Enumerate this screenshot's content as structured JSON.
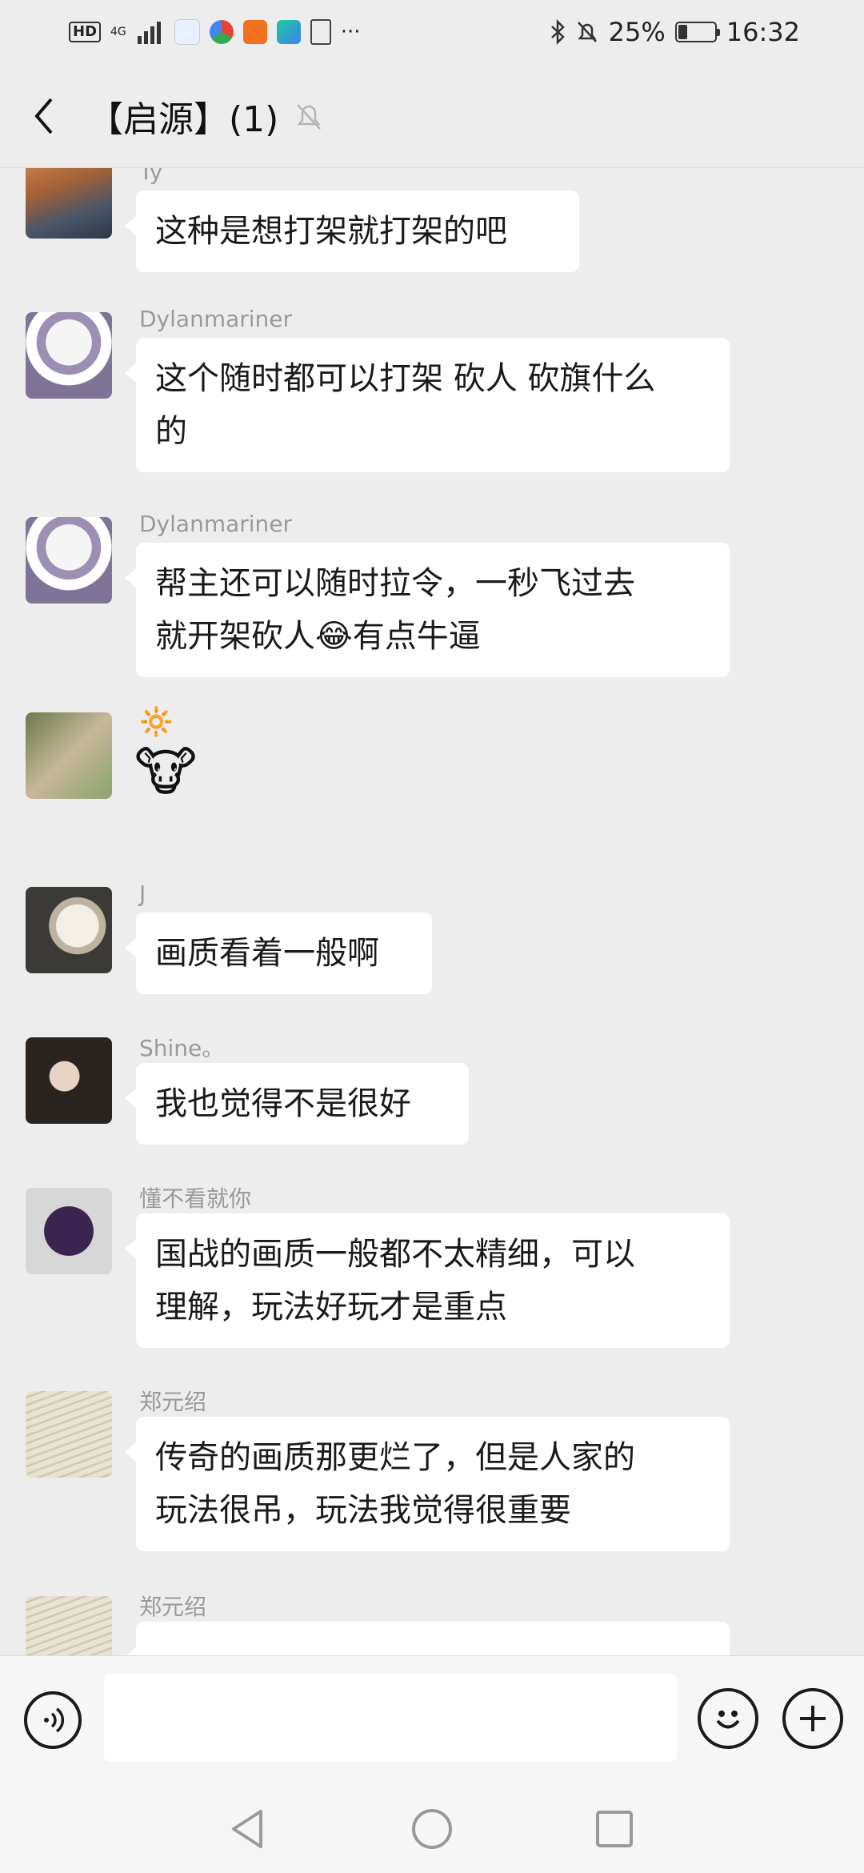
{
  "status_bar": {
    "network": "HD",
    "signal": "4G",
    "battery_percent": "25%",
    "battery_level": 0.25,
    "time": "16:32",
    "more": "···"
  },
  "header": {
    "title": "【启源】(1)"
  },
  "messages": [
    {
      "name": "Ty",
      "text": "这种是想打架就打架的吧"
    },
    {
      "name": "Dylanmariner",
      "text": "这个随时都可以打架 砍人 砍旗什么\n的"
    },
    {
      "name": "Dylanmariner",
      "text": "帮主还可以随时拉令，一秒飞过去\n就开架砍人😂有点牛逼"
    },
    {
      "name": "🔆",
      "text": "🐮"
    },
    {
      "name": "J",
      "text": "画质看着一般啊"
    },
    {
      "name": "Shine。",
      "text": "我也觉得不是很好"
    },
    {
      "name": "懂不看就你",
      "text": "国战的画质一般都不太精细，可以\n理解，玩法好玩才是重点"
    },
    {
      "name": "郑元绍",
      "text": "传奇的画质那更烂了，但是人家的\n玩法很吊，玩法我觉得很重要"
    },
    {
      "name": "郑元绍",
      "text": ""
    }
  ],
  "input": {
    "placeholder": ""
  },
  "icons": {
    "back": "chevron-left-icon",
    "mute": "bell-off-icon",
    "voice": "voice-icon",
    "emoji": "smiley-icon",
    "plus": "plus-icon",
    "nav_back": "triangle-back-icon",
    "nav_home": "circle-home-icon",
    "nav_recent": "square-recent-icon"
  }
}
